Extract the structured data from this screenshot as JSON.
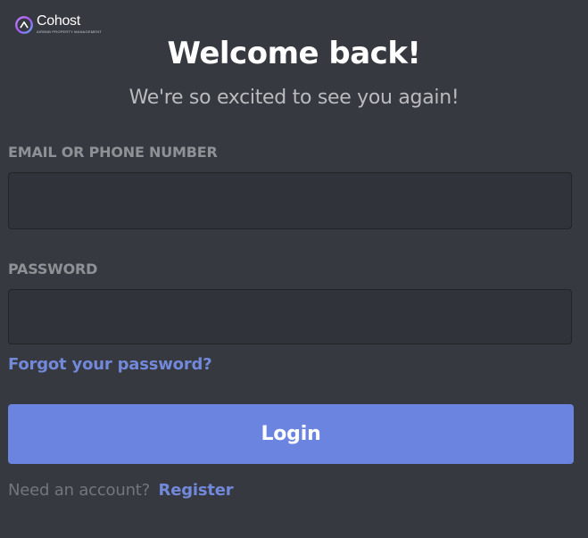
{
  "brand": {
    "name": "Cohost",
    "tagline": "AIRBNB PROPERTY MANAGEMENT",
    "logo_icon": "cohost-logo-icon",
    "colors": {
      "logo_gradient_start": "#a855f7",
      "logo_gradient_end": "#60a5fa"
    }
  },
  "header": {
    "title": "Welcome back!",
    "subtitle": "We're so excited to see you again!"
  },
  "form": {
    "email_label": "EMAIL OR PHONE NUMBER",
    "email_value": "",
    "password_label": "PASSWORD",
    "password_value": "",
    "forgot_password": "Forgot your password?",
    "login_button": "Login",
    "register_prompt": "Need an account?",
    "register_link": "Register"
  },
  "colors": {
    "background": "#36393f",
    "input_background": "#303339",
    "accent": "#7289da",
    "button": "#6b84e0",
    "label": "#8e9297",
    "muted_text": "#72767d"
  }
}
